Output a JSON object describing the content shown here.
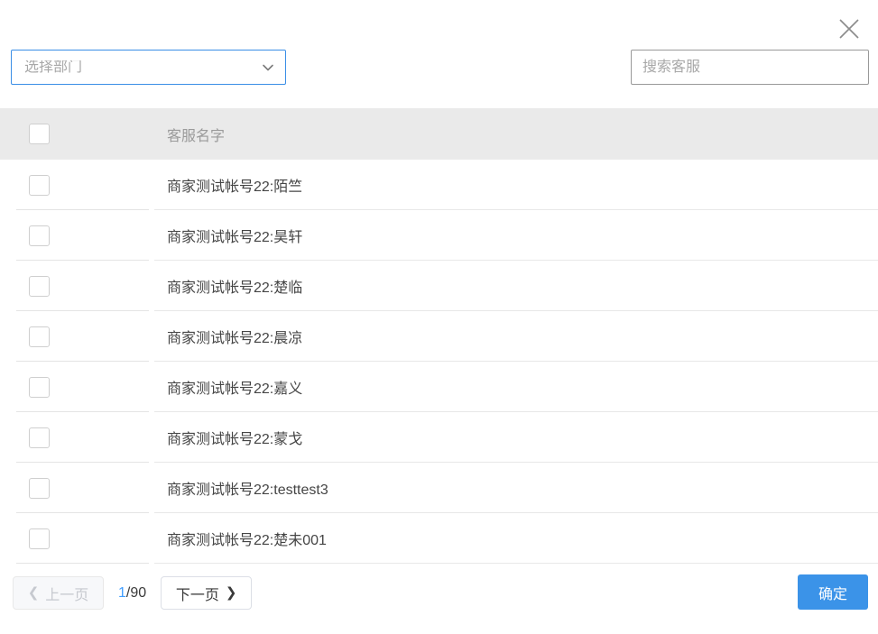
{
  "dialog": {
    "close_icon": "close-icon"
  },
  "filters": {
    "department_select": {
      "placeholder": "选择部门",
      "value": "",
      "icon": "chevron-down-icon",
      "focused_border_color": "#3a8ee6"
    },
    "search": {
      "placeholder": "搜索客服",
      "value": ""
    }
  },
  "table": {
    "header": {
      "select_all_checkbox": "",
      "name_column": "客服名字"
    },
    "rows": [
      {
        "name": "商家测试帐号22:陌竺",
        "checked": false
      },
      {
        "name": "商家测试帐号22:昊轩",
        "checked": false
      },
      {
        "name": "商家测试帐号22:楚临",
        "checked": false
      },
      {
        "name": "商家测试帐号22:晨凉",
        "checked": false
      },
      {
        "name": "商家测试帐号22:嘉义",
        "checked": false
      },
      {
        "name": "商家测试帐号22:蒙戈",
        "checked": false
      },
      {
        "name": "商家测试帐号22:testtest3",
        "checked": false
      },
      {
        "name": "商家测试帐号22:楚未001",
        "checked": false
      }
    ]
  },
  "footer": {
    "prev_label": "上一页",
    "prev_disabled": true,
    "next_label": "下一页",
    "page_current": "1",
    "page_separator": "/",
    "page_total": "90",
    "confirm_label": "确定",
    "confirm_color": "#3b93e8"
  }
}
